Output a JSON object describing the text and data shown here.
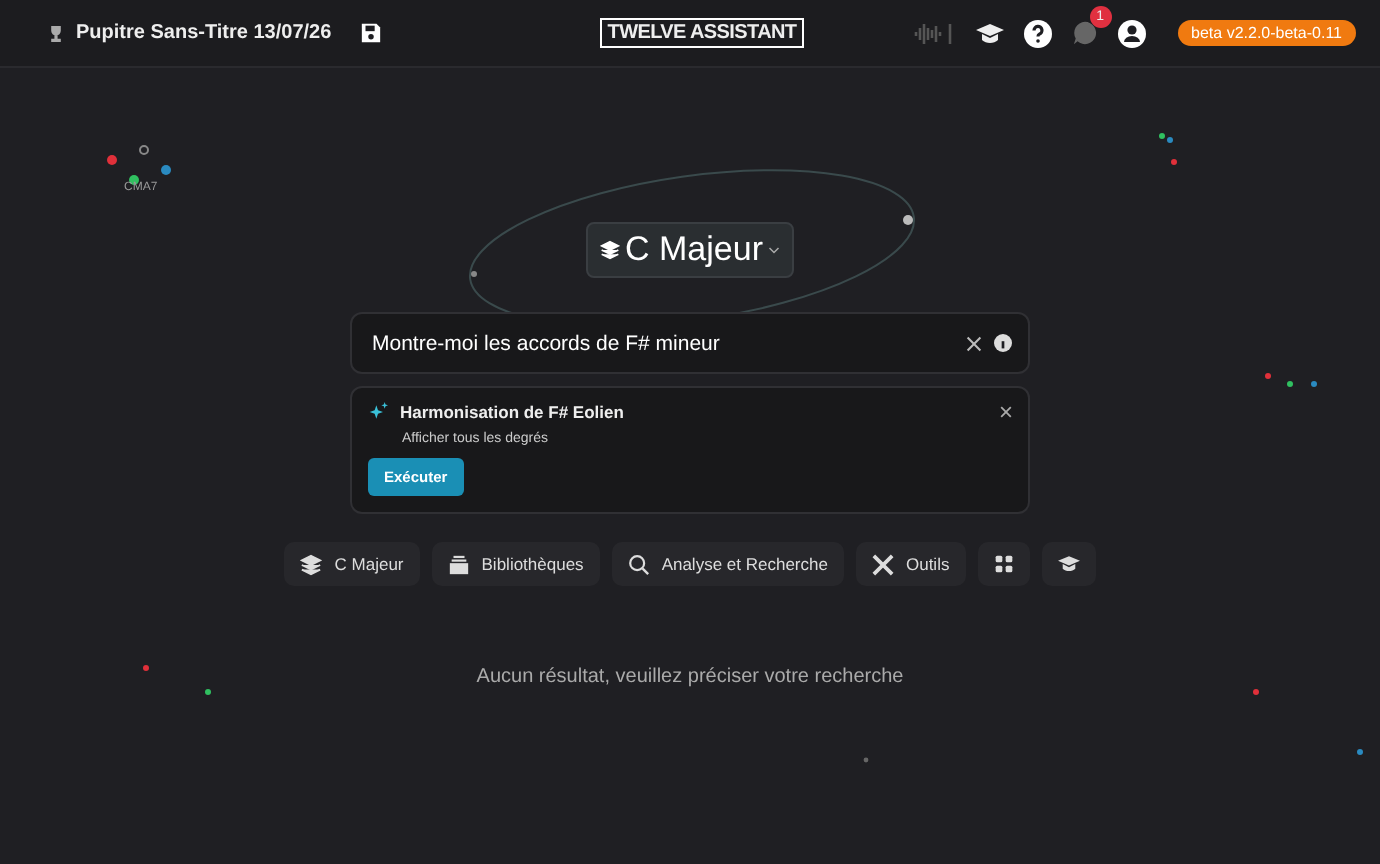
{
  "header": {
    "title": "Pupitre Sans-Titre 13/07/26",
    "logo": "TWELVE ASSISTANT",
    "notification_count": "1",
    "version_badge": "beta v2.2.0-beta-0.11"
  },
  "canvas": {
    "node_label": "CMA7"
  },
  "key_selector": {
    "label": "C Majeur"
  },
  "search": {
    "value": "Montre-moi les accords de F# mineur"
  },
  "suggestion": {
    "title": "Harmonisation de F# Eolien",
    "subtitle": "Afficher tous les degrés",
    "action": "Exécuter"
  },
  "toolbar": [
    {
      "kind": "layers",
      "label": "C Majeur"
    },
    {
      "kind": "library",
      "label": "Bibliothèques"
    },
    {
      "kind": "search",
      "label": "Analyse et Recherche"
    },
    {
      "kind": "tools",
      "label": "Outils"
    },
    {
      "kind": "grid"
    },
    {
      "kind": "cap"
    }
  ],
  "empty_message": "Aucun résultat, veuillez préciser votre recherche"
}
